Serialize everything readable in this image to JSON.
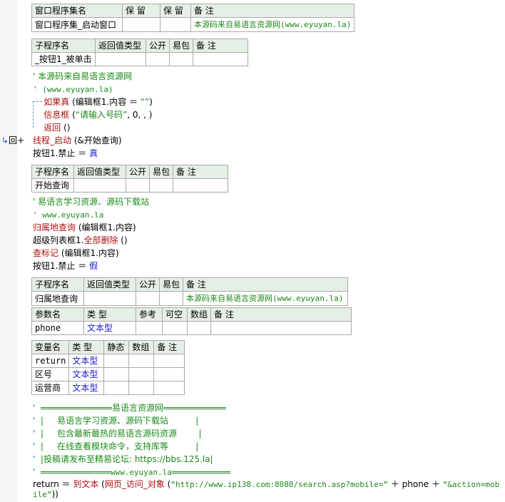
{
  "marker": {
    "left": "↳",
    "right": "回+"
  },
  "window_table": {
    "headers": [
      "窗口程序集名",
      "保 留",
      "保 留",
      "备 注"
    ],
    "row": [
      "窗口程序集_启动窗口",
      "",
      "",
      "本源码来自易语言资源网(www.eyuyan.la)"
    ]
  },
  "sub1": {
    "headers": [
      "子程序名",
      "返回值类型",
      "公开",
      "易包",
      "备 注"
    ],
    "row": [
      "_按钮1_被单击",
      "",
      "",
      "",
      ""
    ]
  },
  "code1": [
    {
      "parts": [
        {
          "c": "c",
          "t": "' 本源码来自易语言资源网"
        }
      ]
    },
    {
      "parts": [
        {
          "c": "c m",
          "t": "' (www.eyuyan.la)"
        }
      ]
    },
    {
      "parts": [
        {
          "c": "r",
          "t": "    如果真"
        },
        {
          "c": "",
          "t": " (编辑框1.内容 ＝ "
        },
        {
          "c": "c",
          "t": "“”"
        },
        {
          "c": "",
          "t": ")"
        }
      ]
    },
    {
      "parts": [
        {
          "c": "r",
          "t": "    信息框"
        },
        {
          "c": "",
          "t": " ("
        },
        {
          "c": "c",
          "t": "“请输入号码”"
        },
        {
          "c": "",
          "t": ", 0, , )"
        }
      ]
    },
    {
      "parts": [
        {
          "c": "r",
          "t": "    返回"
        },
        {
          "c": "",
          "t": " ()"
        }
      ]
    },
    {
      "parts": [
        {
          "c": "r",
          "t": "线程_启动"
        },
        {
          "c": "",
          "t": " (&开始查询)"
        }
      ]
    },
    {
      "parts": [
        {
          "c": "",
          "t": "按钮1.禁止 ＝ "
        },
        {
          "c": "bl2",
          "t": "真"
        }
      ]
    }
  ],
  "sub2": {
    "headers": [
      "子程序名",
      "返回值类型",
      "公开",
      "易包",
      "备 注"
    ],
    "row": [
      "开始查询",
      "",
      "",
      "",
      ""
    ]
  },
  "code2": [
    {
      "parts": [
        {
          "c": "c",
          "t": "' 易语言学习资源、源码下载站"
        }
      ]
    },
    {
      "parts": [
        {
          "c": "c m",
          "t": "' www.eyuyan.la"
        }
      ]
    },
    {
      "parts": [
        {
          "c": "r",
          "t": "归属地查询"
        },
        {
          "c": "",
          "t": " (编辑框1.内容)"
        }
      ]
    },
    {
      "parts": [
        {
          "c": "",
          "t": "超级列表框1."
        },
        {
          "c": "r",
          "t": "全部删除"
        },
        {
          "c": "",
          "t": " ()"
        }
      ]
    },
    {
      "parts": [
        {
          "c": "r",
          "t": "查标记"
        },
        {
          "c": "",
          "t": " (编辑框1.内容)"
        }
      ]
    },
    {
      "parts": [
        {
          "c": "",
          "t": "按钮1.禁止 ＝ "
        },
        {
          "c": "bl2",
          "t": "假"
        }
      ]
    }
  ],
  "sub3": {
    "headers": [
      "子程序名",
      "返回值类型",
      "公开",
      "易包",
      "备 注"
    ],
    "row": [
      "归属地查询",
      "",
      "",
      "",
      "本源码来自易语言资源网(www.eyuyan.la)"
    ]
  },
  "param_table": {
    "headers": [
      "参数名",
      "类 型",
      "参考",
      "可空",
      "数组",
      "备 注"
    ],
    "row": [
      "phone",
      "文本型",
      "",
      "",
      "",
      ""
    ]
  },
  "var_table": {
    "headers": [
      "变量名",
      "类 型",
      "静态",
      "数组",
      "备 注"
    ],
    "rows": [
      [
        "return",
        "文本型",
        "",
        "",
        ""
      ],
      [
        "区号",
        "文本型",
        "",
        "",
        ""
      ],
      [
        "运营商",
        "文本型",
        "",
        "",
        ""
      ]
    ]
  },
  "banner": {
    "title": "易语言资源网",
    "lines": [
      "'  |     易语言学习资源、源码下载站          |",
      "'  |     包含最新最热的易语言源码资源        |",
      "'  |     在线查看模块命令，支持库等          |",
      "'  |投稿请发布至精易论坛: https://bbs.125.la|"
    ],
    "footer": "www.eyuyan.la"
  },
  "last_line": {
    "parts": [
      {
        "c": "",
        "t": "return ＝ "
      },
      {
        "c": "r",
        "t": "到文本"
      },
      {
        "c": "",
        "t": " ("
      },
      {
        "c": "r",
        "t": "网页_访问_对象"
      },
      {
        "c": "",
        "t": " ("
      },
      {
        "c": "c m",
        "t": "“http://www.ip138.com:8080/search.asp?mobile=”"
      },
      {
        "c": "",
        "t": " ＋ phone ＋ "
      },
      {
        "c": "c m",
        "t": "“&action=mob"
      }
    ],
    "cont": [
      {
        "c": "c m",
        "t": "ile”"
      },
      {
        "c": "",
        "t": "))"
      }
    ]
  }
}
